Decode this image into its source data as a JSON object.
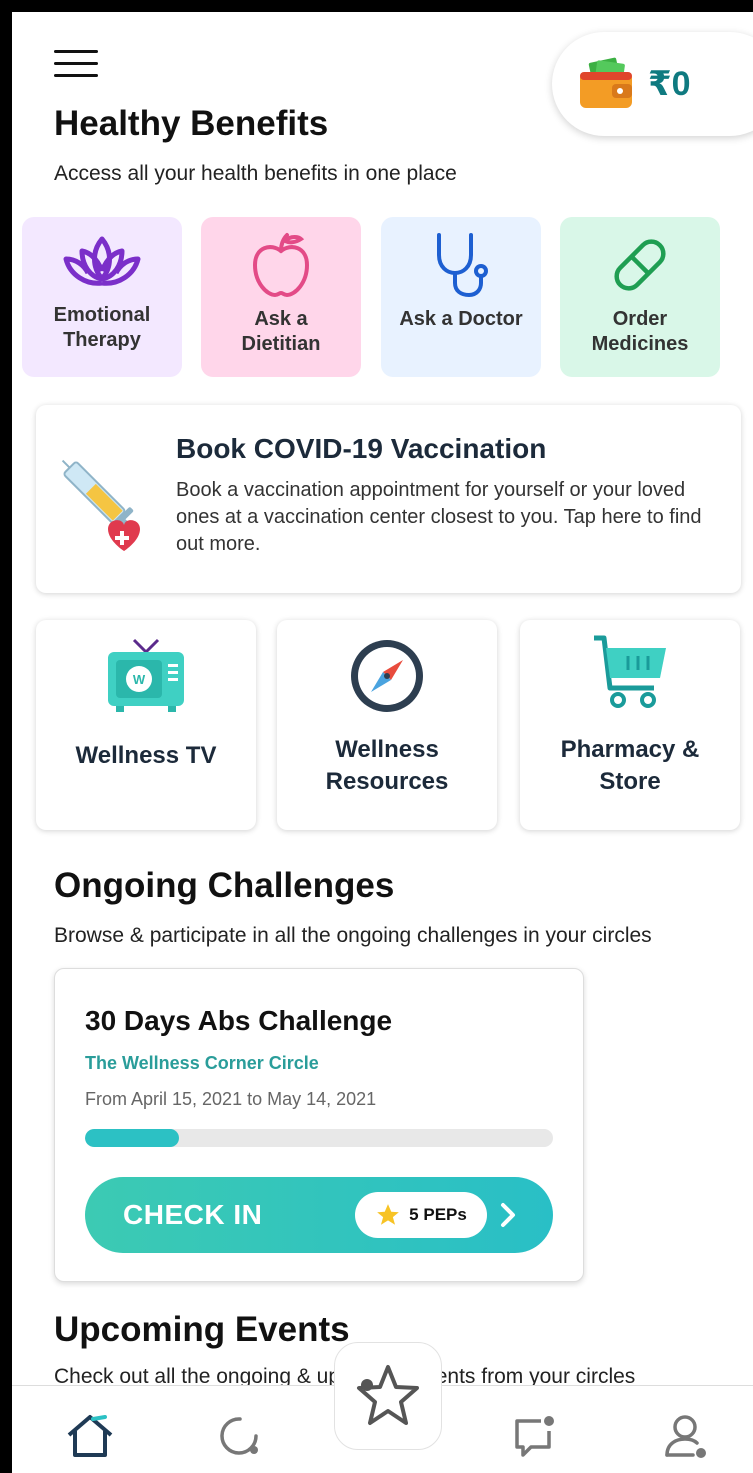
{
  "header": {
    "wallet_amount": "₹0"
  },
  "benefits": {
    "title": "Healthy Benefits",
    "subtitle": "Access all your health benefits in one place",
    "items": [
      {
        "label": "Emotional\nTherapy",
        "icon": "lotus-icon",
        "bg": "#f3e8ff"
      },
      {
        "label": "Ask a\nDietitian",
        "icon": "apple-icon",
        "bg": "#ffd6ea"
      },
      {
        "label": "Ask a Doctor",
        "icon": "stethoscope-icon",
        "bg": "#e8f2ff"
      },
      {
        "label": "Order\nMedicines",
        "icon": "pill-icon",
        "bg": "#d9f7e8"
      }
    ]
  },
  "covid": {
    "title": "Book COVID-19 Vaccination",
    "description": "Book a vaccination appointment for yourself or your loved ones at a vaccination center closest to you. Tap here to find out more."
  },
  "tiles": [
    {
      "label": "Wellness TV",
      "icon": "tv-icon"
    },
    {
      "label": "Wellness\nResources",
      "icon": "compass-icon"
    },
    {
      "label": "Pharmacy &\nStore",
      "icon": "cart-icon"
    }
  ],
  "challenges": {
    "title": "Ongoing Challenges",
    "subtitle": "Browse & participate in all the ongoing challenges in your circles",
    "card": {
      "title": "30 Days Abs Challenge",
      "circle": "The Wellness Corner Circle",
      "dates": "From April 15, 2021 to May 14, 2021",
      "progress": 0.2,
      "checkin_label": "CHECK IN",
      "peps_label": "5 PEPs"
    }
  },
  "events": {
    "title": "Upcoming Events",
    "subtitle": "Check out all the ongoing & upcoming events from your circles"
  },
  "colors": {
    "accent": "#2cc1c4",
    "teal_text": "#0f7a80",
    "circle_green": "#2a9d9a"
  }
}
